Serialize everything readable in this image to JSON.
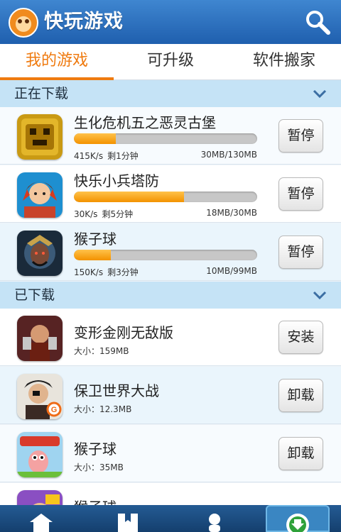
{
  "header": {
    "title": "快玩游戏",
    "logo_icon": "monkey-logo-icon",
    "search_icon": "search-icon"
  },
  "tabs": [
    {
      "label": "我的游戏",
      "active": true
    },
    {
      "label": "可升级",
      "active": false
    },
    {
      "label": "软件搬家",
      "active": false
    }
  ],
  "downloading": {
    "label": "正在下载",
    "items": [
      {
        "name": "生化危机五之恶灵古堡",
        "progress": 0.23,
        "speed": "415K/s",
        "remaining": "剩1分钟",
        "size": "30MB/130MB",
        "button": "暂停",
        "icon": "temple-run-game-icon"
      },
      {
        "name": "快乐小兵塔防",
        "progress": 0.6,
        "speed": "30K/s",
        "remaining": "剩5分钟",
        "size": "18MB/30MB",
        "button": "暂停",
        "icon": "warrior-girl-game-icon"
      },
      {
        "name": "猴子球",
        "progress": 0.1,
        "speed": "150K/s",
        "remaining": "剩3分钟",
        "size": "10MB/99MB",
        "button": "暂停",
        "icon": "three-kingdoms-game-icon"
      }
    ]
  },
  "downloaded": {
    "label": "已下载",
    "items": [
      {
        "name": "变形金刚无敌版",
        "size": "大小：159MB",
        "button": "安装",
        "icon": "brawler-game-icon"
      },
      {
        "name": "保卫世界大战",
        "size": "大小：12.3MB",
        "button": "卸载",
        "icon": "pirate-game-icon"
      },
      {
        "name": "猴子球",
        "size": "大小：35MB",
        "button": "卸载",
        "icon": "worms-game-icon"
      },
      {
        "name": "猴子球",
        "size": "",
        "button": "",
        "icon": "hero-game-icon"
      }
    ]
  },
  "bottom_nav": [
    {
      "icon": "home-icon"
    },
    {
      "icon": "bookmark-icon"
    },
    {
      "icon": "user-icon"
    },
    {
      "icon": "download-icon",
      "active": true
    }
  ],
  "colors": {
    "accent": "#ef7a0f",
    "header": "#2a6cba",
    "section": "#c5e3f6"
  }
}
